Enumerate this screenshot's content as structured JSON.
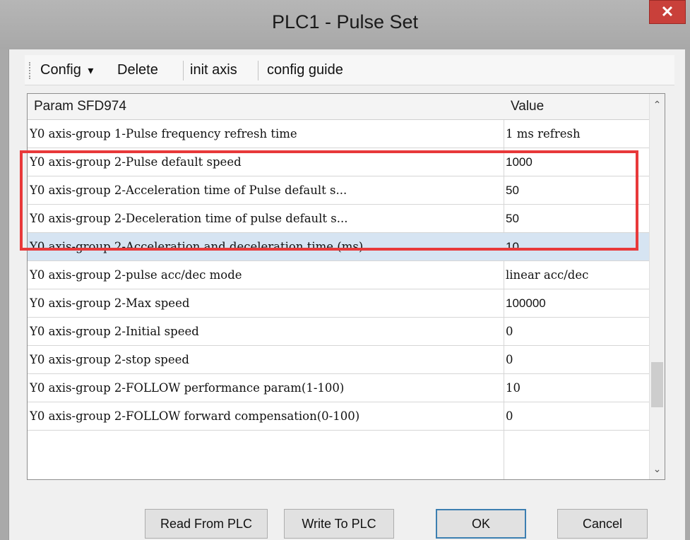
{
  "window": {
    "title": "PLC1 - Pulse  Set",
    "close_glyph": "✕"
  },
  "toolbar": {
    "config_label": "Config",
    "config_arrow": "▾",
    "delete_label": "Delete",
    "init_axis_label": "init axis",
    "config_guide_label": "config guide"
  },
  "grid": {
    "columns": [
      "Param SFD974",
      "Value"
    ],
    "rows": [
      {
        "name": "Y0 axis-group 1-Pulse frequency refresh time",
        "value": "1 ms refresh"
      },
      {
        "name": "Y0 axis-group 2-Pulse default speed",
        "value": "1000"
      },
      {
        "name": "Y0 axis-group 2-Acceleration time of Pulse default s...",
        "value": "50"
      },
      {
        "name": "Y0 axis-group 2-Deceleration time of pulse default s...",
        "value": "50"
      },
      {
        "name": "Y0 axis-group 2-Acceleration and deceleration time (ms)",
        "value": "10"
      },
      {
        "name": "Y0 axis-group 2-pulse acc/dec mode",
        "value": "linear acc/dec"
      },
      {
        "name": "Y0 axis-group 2-Max speed",
        "value": "100000"
      },
      {
        "name": "Y0 axis-group 2-Initial speed",
        "value": "0"
      },
      {
        "name": "Y0 axis-group 2-stop speed",
        "value": "0"
      },
      {
        "name": "Y0 axis-group 2-FOLLOW performance param(1-100)",
        "value": "10"
      },
      {
        "name": "Y0 axis-group 2-FOLLOW forward compensation(0-100)",
        "value": "0"
      }
    ],
    "scroll_up_glyph": "⌃",
    "scroll_down_glyph": "⌄"
  },
  "buttons": {
    "read": "Read From PLC",
    "write": "Write To PLC",
    "ok": "OK",
    "cancel": "Cancel"
  },
  "colors": {
    "highlight": "#e8393a",
    "selected_row": "#d6e4f2",
    "close": "#c9403a"
  }
}
